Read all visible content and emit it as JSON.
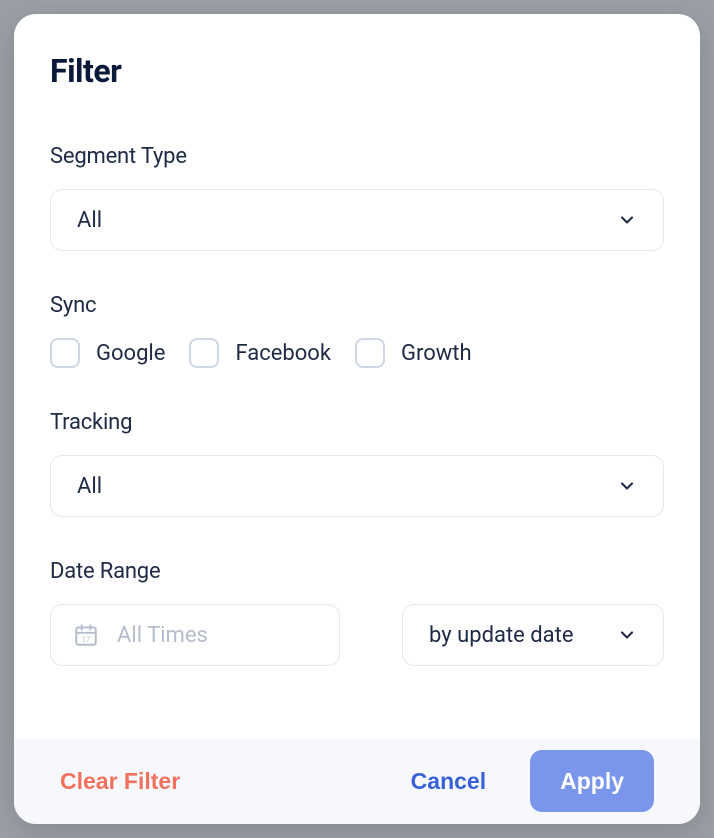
{
  "title": "Filter",
  "segmentType": {
    "label": "Segment Type",
    "value": "All"
  },
  "sync": {
    "label": "Sync",
    "options": [
      {
        "label": "Google"
      },
      {
        "label": "Facebook"
      },
      {
        "label": "Growth"
      }
    ]
  },
  "tracking": {
    "label": "Tracking",
    "value": "All"
  },
  "dateRange": {
    "label": "Date Range",
    "placeholder": "All Times",
    "modeValue": "by update date"
  },
  "footer": {
    "clear": "Clear Filter",
    "cancel": "Cancel",
    "apply": "Apply"
  }
}
